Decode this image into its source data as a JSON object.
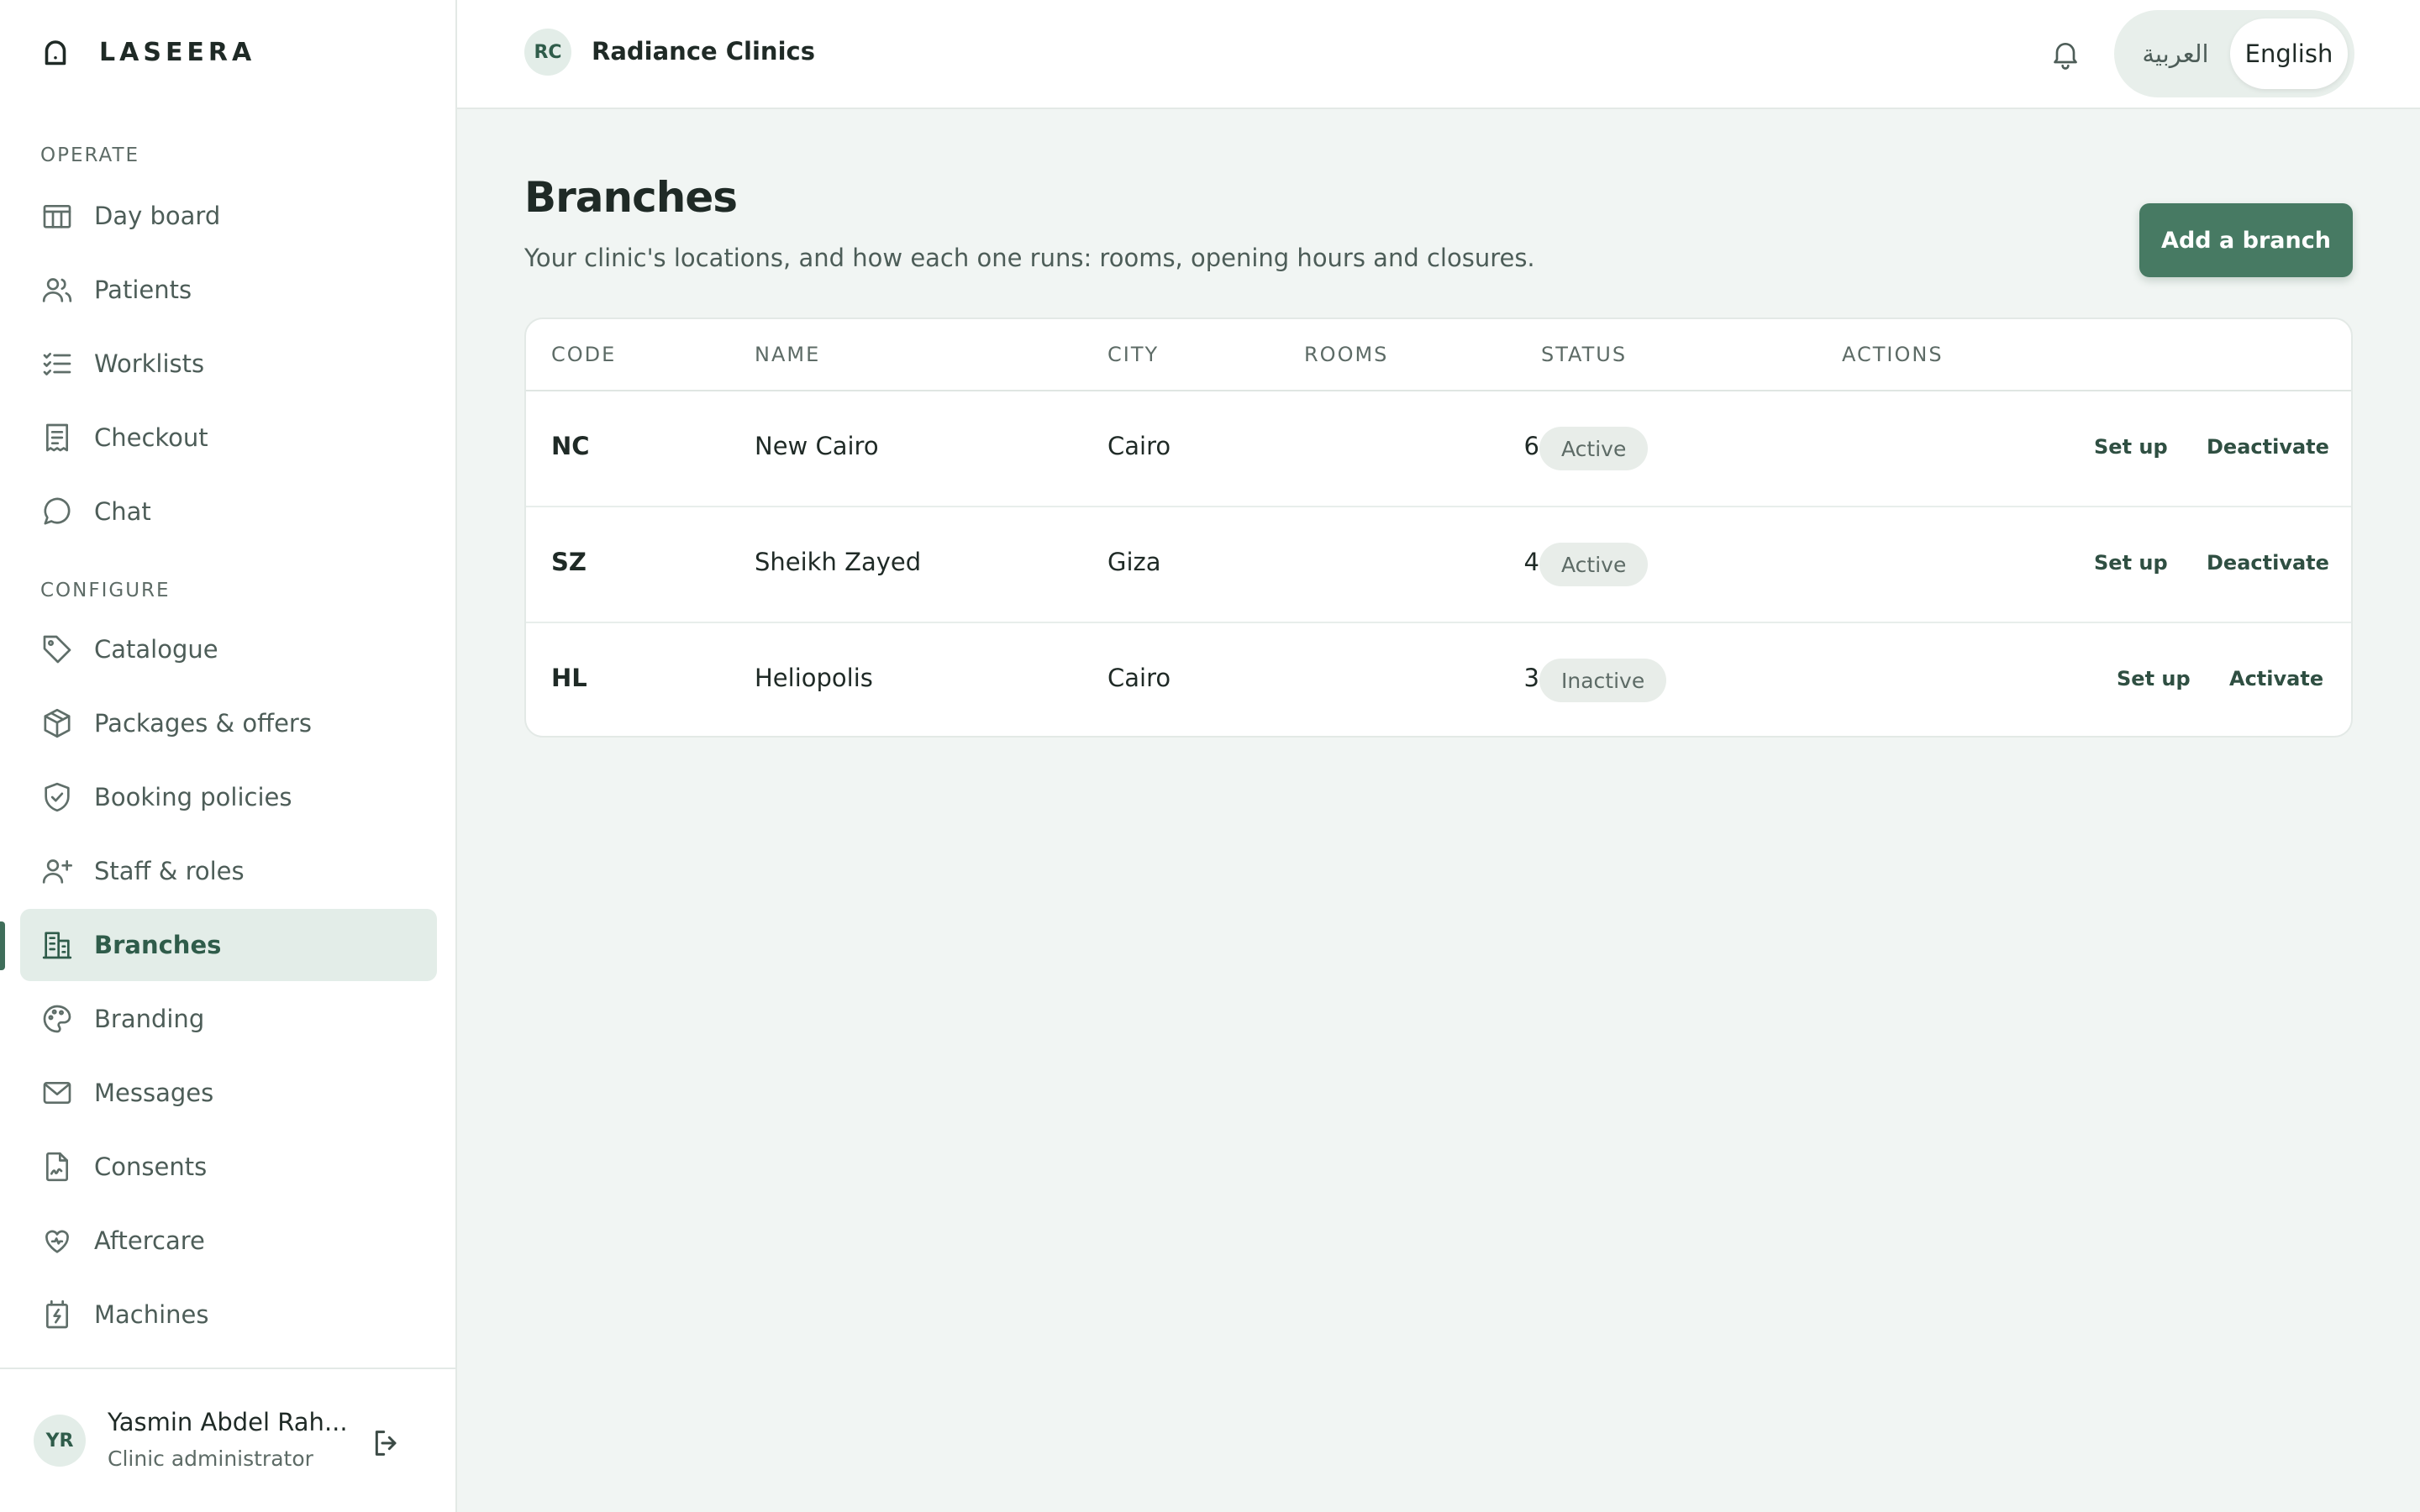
{
  "app": {
    "brand": "LASEERA"
  },
  "sidebar": {
    "operate_label": "OPERATE",
    "configure_label": "CONFIGURE",
    "operate_items": [
      {
        "label": "Day board",
        "icon": "calendar-board-icon"
      },
      {
        "label": "Patients",
        "icon": "users-icon"
      },
      {
        "label": "Worklists",
        "icon": "list-check-icon"
      },
      {
        "label": "Checkout",
        "icon": "receipt-icon"
      },
      {
        "label": "Chat",
        "icon": "chat-bubble-icon"
      }
    ],
    "configure_items": [
      {
        "label": "Catalogue",
        "icon": "tag-icon"
      },
      {
        "label": "Packages & offers",
        "icon": "package-icon"
      },
      {
        "label": "Booking policies",
        "icon": "shield-check-icon"
      },
      {
        "label": "Staff & roles",
        "icon": "user-plus-icon"
      },
      {
        "label": "Branches",
        "icon": "building-icon",
        "active": true
      },
      {
        "label": "Branding",
        "icon": "palette-icon"
      },
      {
        "label": "Messages",
        "icon": "mail-icon"
      },
      {
        "label": "Consents",
        "icon": "signed-document-icon"
      },
      {
        "label": "Aftercare",
        "icon": "heart-care-icon"
      },
      {
        "label": "Machines",
        "icon": "machine-bolt-icon"
      }
    ],
    "user": {
      "initials": "YR",
      "name": "Yasmin Abdel Rah...",
      "role": "Clinic administrator"
    }
  },
  "topbar": {
    "org_initials": "RC",
    "org_name": "Radiance Clinics",
    "lang_ar": "العربية",
    "lang_en": "English",
    "selected_lang": "English"
  },
  "page": {
    "title": "Branches",
    "subtitle": "Your clinic's locations, and how each one runs: rooms, opening hours and closures.",
    "add_button": "Add a branch"
  },
  "table": {
    "headers": {
      "code": "CODE",
      "name": "NAME",
      "city": "CITY",
      "rooms": "ROOMS",
      "status": "STATUS",
      "actions": "ACTIONS"
    },
    "rows": [
      {
        "code": "NC",
        "name": "New Cairo",
        "city": "Cairo",
        "rooms": "6",
        "status": "Active",
        "setup": "Set up",
        "toggle": "Deactivate"
      },
      {
        "code": "SZ",
        "name": "Sheikh Zayed",
        "city": "Giza",
        "rooms": "4",
        "status": "Active",
        "setup": "Set up",
        "toggle": "Deactivate"
      },
      {
        "code": "HL",
        "name": "Heliopolis",
        "city": "Cairo",
        "rooms": "3",
        "status": "Inactive",
        "setup": "Set up",
        "toggle": "Activate"
      }
    ]
  },
  "colors": {
    "accent": "#477a63",
    "active_nav_bg": "#e3ede8",
    "background": "#f1f5f3"
  }
}
